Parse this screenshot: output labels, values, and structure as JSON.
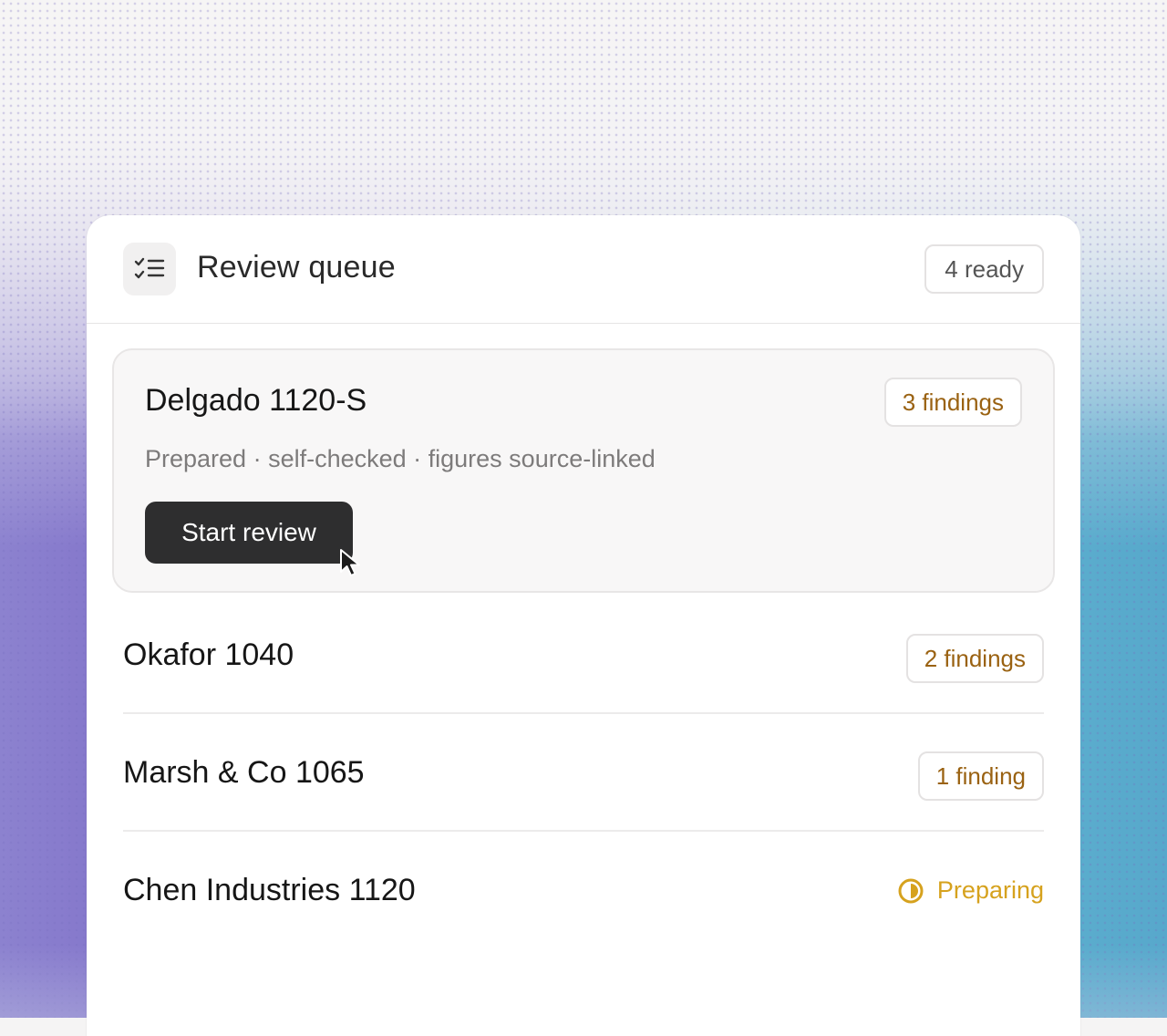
{
  "colors": {
    "accent_amber": "#9a6212",
    "preparing_yellow": "#d6a21e",
    "button_dark": "#2e2e2f"
  },
  "header": {
    "icon": "checklist-icon",
    "title": "Review queue",
    "badge": "4 ready"
  },
  "active_item": {
    "title": "Delgado 1120-S",
    "findings": "3 findings",
    "subtitle": "Prepared · self-checked · figures source-linked",
    "button_label": "Start review"
  },
  "rows": [
    {
      "title": "Okafor 1040",
      "findings": "2 findings"
    },
    {
      "title": "Marsh & Co 1065",
      "findings": "1 finding"
    },
    {
      "title": "Chen Industries 1120",
      "status": "Preparing",
      "status_icon": "half-circle-icon"
    }
  ]
}
